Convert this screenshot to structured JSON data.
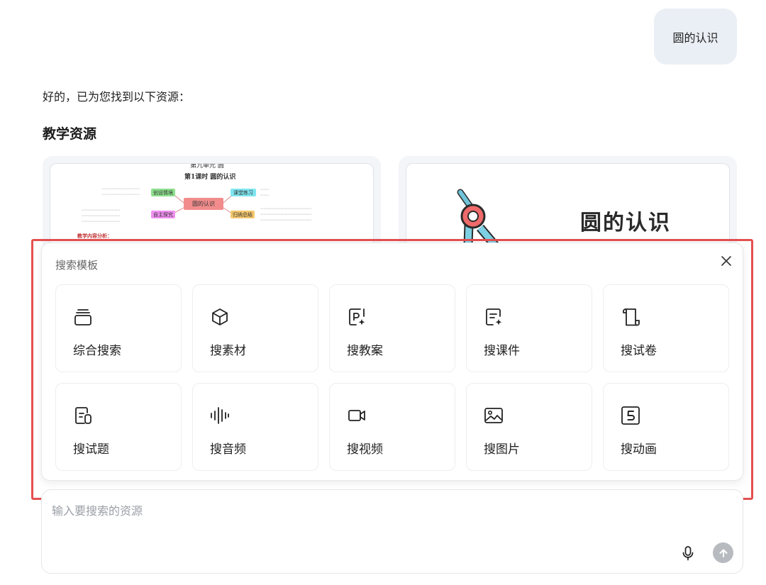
{
  "user_message": "圆的认识",
  "reply_text": "好的，已为您找到以下资源：",
  "section_title": "教学资源",
  "resource_cards": [
    {
      "header": "第九单元 圆",
      "subheader": "第1课时 圆的认识",
      "center_node": "圆的认识",
      "nodes": [
        "创设情境",
        "自主探究",
        "课堂练习",
        "归纳总结"
      ],
      "section_label": "教学内容分析："
    },
    {
      "title": "圆的认识"
    }
  ],
  "search_panel": {
    "title": "搜索模板",
    "templates": [
      {
        "label": "综合搜索",
        "icon": "layers-icon"
      },
      {
        "label": "搜素材",
        "icon": "cube-icon"
      },
      {
        "label": "搜教案",
        "icon": "lesson-plan-icon"
      },
      {
        "label": "搜课件",
        "icon": "courseware-icon"
      },
      {
        "label": "搜试卷",
        "icon": "scroll-icon"
      },
      {
        "label": "搜试题",
        "icon": "question-icon"
      },
      {
        "label": "搜音频",
        "icon": "audio-wave-icon"
      },
      {
        "label": "搜视频",
        "icon": "video-camera-icon"
      },
      {
        "label": "搜图片",
        "icon": "image-icon"
      },
      {
        "label": "搜动画",
        "icon": "html5-icon"
      }
    ]
  },
  "input": {
    "placeholder": "输入要搜索的资源",
    "value": ""
  },
  "colors": {
    "highlight_border": "#e45050",
    "user_bubble": "#eaeff5",
    "send_button": "#b7babf"
  }
}
